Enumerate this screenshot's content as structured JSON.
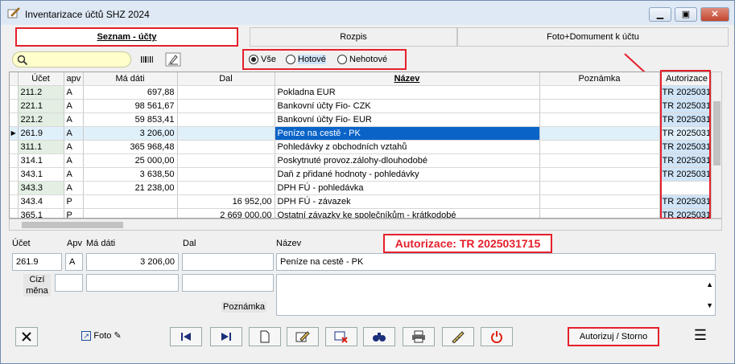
{
  "window": {
    "title": "Inventarizace účtů SHZ 2024"
  },
  "tabs": [
    {
      "label": "Seznam - účty"
    },
    {
      "label": "Rozpis"
    },
    {
      "label": "Foto+Domument k účtu"
    }
  ],
  "search": {
    "value": ""
  },
  "filter": {
    "all": "Vše",
    "done": "Hotové",
    "notdone": "Nehotové",
    "selected": "Vše"
  },
  "grid": {
    "columns": [
      "Účet",
      "apv",
      "Má dáti",
      "Dal",
      "Název",
      "Poznámka",
      "Autorizace"
    ],
    "rows": [
      {
        "ucet": "211.2",
        "apv": "A",
        "madati": "697,88",
        "dal": "",
        "nazev": "Pokladna EUR",
        "pozn": "",
        "auth": "TR  2025031"
      },
      {
        "ucet": "221.1",
        "apv": "A",
        "madati": "98 561,67",
        "dal": "",
        "nazev": "Bankovní účty Fio- CZK",
        "pozn": "",
        "auth": "TR  2025031"
      },
      {
        "ucet": "221.2",
        "apv": "A",
        "madati": "59 853,41",
        "dal": "",
        "nazev": "Bankovní účty Fio- EUR",
        "pozn": "",
        "auth": "TR  2025031"
      },
      {
        "ucet": "261.9",
        "apv": "A",
        "madati": "3 206,00",
        "dal": "",
        "nazev": "Peníze na cestě - PK",
        "pozn": "",
        "auth": "TR  2025031"
      },
      {
        "ucet": "311.1",
        "apv": "A",
        "madati": "365 968,48",
        "dal": "",
        "nazev": "Pohledávky z obchodních vztahů",
        "pozn": "",
        "auth": "TR  2025031"
      },
      {
        "ucet": "314.1",
        "apv": "A",
        "madati": "25 000,00",
        "dal": "",
        "nazev": "Poskytnuté provoz.zálohy-dlouhodobé",
        "pozn": "",
        "auth": "TR  2025031"
      },
      {
        "ucet": "343.1",
        "apv": "A",
        "madati": "3 638,50",
        "dal": "",
        "nazev": "Daň z přidané hodnoty - pohledávky",
        "pozn": "",
        "auth": "TR  2025031"
      },
      {
        "ucet": "343.3",
        "apv": "A",
        "madati": "21 238,00",
        "dal": "",
        "nazev": "DPH FÚ - pohledávka",
        "pozn": "",
        "auth": ""
      },
      {
        "ucet": "343.4",
        "apv": "P",
        "madati": "",
        "dal": "16 952,00",
        "nazev": "DPH FÚ - závazek",
        "pozn": "",
        "auth": "TR  2025031"
      },
      {
        "ucet": "365.1",
        "apv": "P",
        "madati": "",
        "dal": "2 669 000,00",
        "nazev": "Ostatní závazky ke společníkům - krátkodobé",
        "pozn": "",
        "auth": "TR  2025031"
      }
    ]
  },
  "detail": {
    "ucet_label": "Účet",
    "apv_label": "Apv",
    "madati_label": "Má dáti",
    "dal_label": "Dal",
    "nazev_label": "Název",
    "ucet": "261.9",
    "apv": "A",
    "madati": "3 206,00",
    "dal": "",
    "nazev": "Peníze na cestě - PK",
    "cizi_mena_label": "Cizí měna",
    "poznamka_label": "Poznámka",
    "autorizace_text": "Autorizace: TR   2025031715"
  },
  "bottom": {
    "foto_label": "Foto",
    "authorize_label": "Autorizuj / Storno"
  }
}
